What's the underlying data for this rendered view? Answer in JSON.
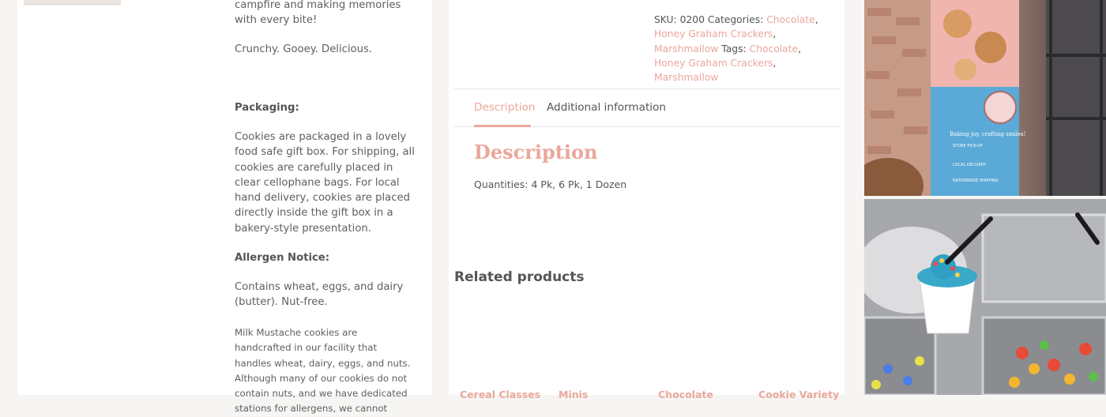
{
  "left": {
    "intro_tail": "campfire and making memories with every bite!",
    "tagline": "Crunchy. Gooey. Delicious.",
    "packaging_heading": "Packaging:",
    "packaging_text": "Cookies are packaged in a lovely food safe gift box. For shipping, all cookies are carefully placed in clear cellophane bags. For local hand delivery, cookies are placed directly inside the gift box in a bakery-style presentation.",
    "allergen_heading": "Allergen Notice:",
    "allergen_text": "Contains wheat, eggs, and dairy (butter). Nut-free.",
    "allergen_detail": "Milk Mustache cookies are handcrafted in our facility that handles wheat, dairy, eggs, and nuts. Although many of our cookies do not contain nuts, and we have dedicated stations for allergens, we cannot"
  },
  "meta": {
    "sku_label": "SKU:",
    "sku_value": "0200",
    "categories_label": "Categories:",
    "categories": [
      "Chocolate",
      "Honey Graham Crackers",
      "Marshmallow"
    ],
    "tags_label": "Tags:",
    "tags": [
      "Chocolate",
      "Honey Graham Crackers",
      "Marshmallow"
    ]
  },
  "tabs": {
    "description": "Description",
    "additional": "Additional information"
  },
  "description": {
    "heading": "Description",
    "quantities": "Quantities: 4 Pk, 6 Pk, 1 Dozen"
  },
  "related": {
    "heading": "Related products",
    "products": [
      "Cereal Classes",
      "Minis",
      "Chocolate",
      "Cookie Variety"
    ]
  },
  "photos": {
    "banner_text": "Baking joy, crafting smiles!",
    "banner_items": [
      "STORE PICK-UP",
      "LOCAL DELIVERY",
      "NATIONWIDE SHIPPING"
    ]
  },
  "colors": {
    "accent": "#eaa79b",
    "text": "#5f5f5f",
    "background": "#f6f5f3"
  }
}
